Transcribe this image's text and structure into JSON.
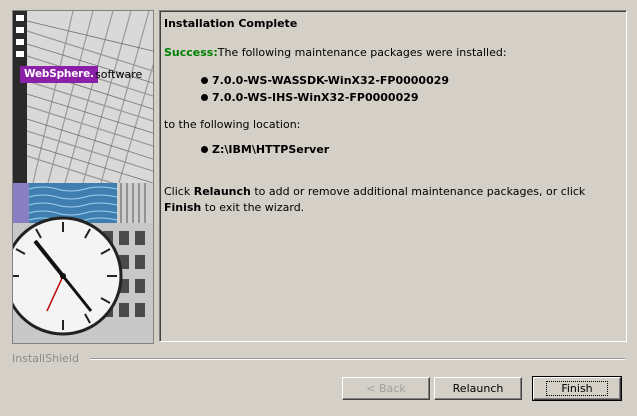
{
  "banner": {
    "brand": "WebSphere.",
    "product": "software"
  },
  "content": {
    "title": "Installation Complete",
    "success_label": "Success:",
    "success_text": "The following maintenance packages were installed:",
    "packages": [
      "7.0.0-WS-WASSDK-WinX32-FP0000029",
      "7.0.0-WS-IHS-WinX32-FP0000029"
    ],
    "location_intro": "to the following location:",
    "location": "Z:\\IBM\\HTTPServer",
    "para_1": "Click ",
    "para_relaunch": "Relaunch",
    "para_2": " to add or remove additional maintenance packages, or click ",
    "para_finish": "Finish",
    "para_3": " to exit the wizard."
  },
  "footer": {
    "installshield": "InstallShield"
  },
  "buttons": {
    "back": "< Back",
    "relaunch": "Relaunch",
    "finish": "Finish"
  },
  "colors": {
    "background": "#d4d0c8",
    "success": "#008000",
    "brand_badge": "#8b1fa8"
  }
}
